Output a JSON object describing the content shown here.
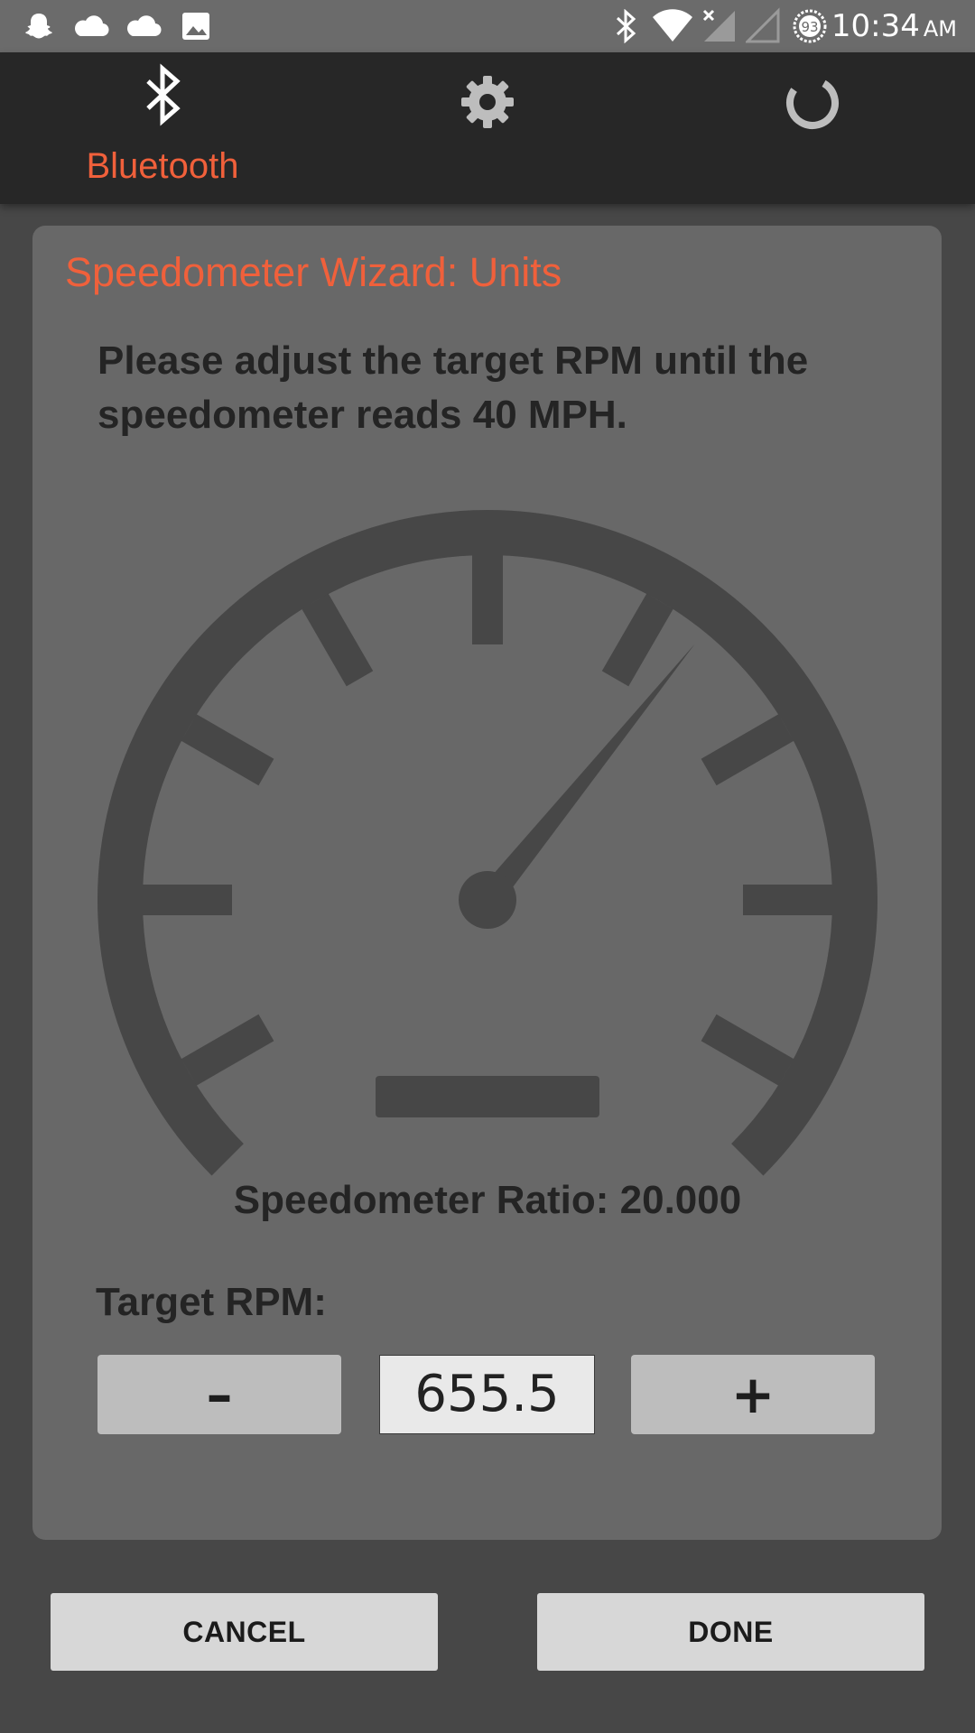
{
  "status_bar": {
    "battery_level": "93",
    "time": "10:34",
    "ampm": "AM",
    "left_icons": [
      "snapchat-icon",
      "cloud-icon",
      "cloud-icon",
      "image-icon"
    ],
    "right_icons": [
      "bluetooth-icon",
      "wifi-icon",
      "no-signal-icon",
      "signal-icon",
      "battery-icon"
    ]
  },
  "tabs": [
    {
      "label": "Bluetooth",
      "icon": "bluetooth-icon",
      "active": true
    },
    {
      "label": "",
      "icon": "gear-icon",
      "active": false
    },
    {
      "label": "",
      "icon": "loading-icon",
      "active": false
    }
  ],
  "wizard": {
    "title": "Speedometer Wizard: Units",
    "instruction": "Please adjust the target RPM until the speedometer reads 40 MPH.",
    "ratio_label": "Speedometer Ratio: 20.000",
    "target_label": "Target RPM:",
    "minus_label": "–",
    "plus_label": "+",
    "rpm_value": "655.5"
  },
  "actions": {
    "cancel_label": "CANCEL",
    "done_label": "DONE"
  },
  "colors": {
    "accent": "#f0603b",
    "background": "#474747",
    "card": "#686868",
    "tab_bar": "#272727",
    "gauge": "#474747"
  }
}
